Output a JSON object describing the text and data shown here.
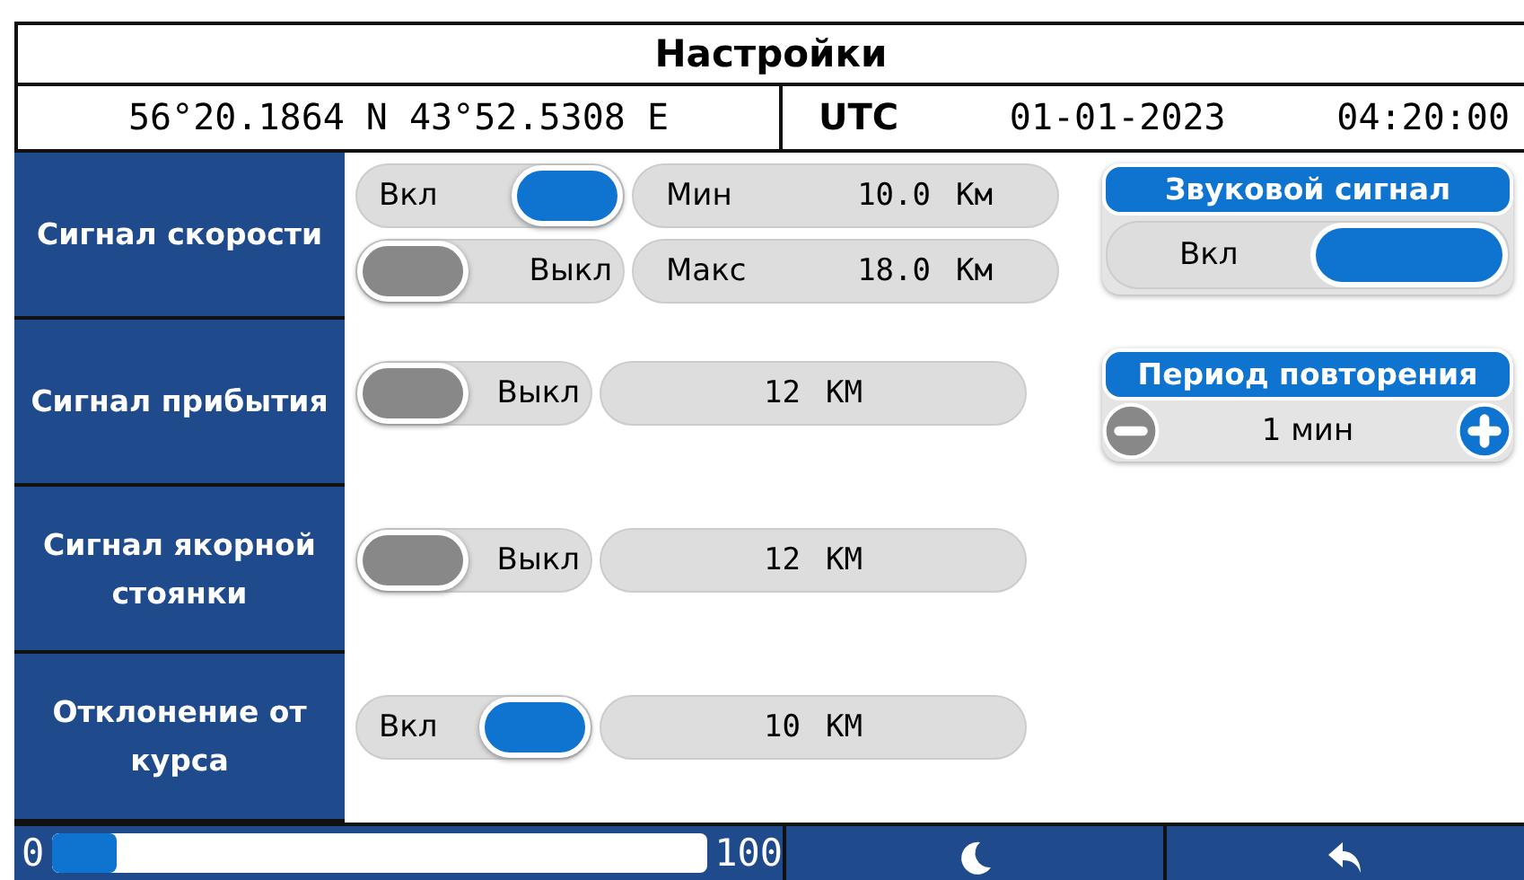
{
  "title": "Настройки",
  "position": {
    "coordinates": "56°20.1864 N 43°52.5308 E",
    "timezone": "UTC",
    "date": "01-01-2023",
    "time": "04:20:00"
  },
  "alarms": [
    {
      "label": "Сигнал скорости",
      "toggles": [
        {
          "state_label": "Вкл",
          "on": true
        },
        {
          "state_label": "Выкл",
          "on": false
        }
      ],
      "values": [
        {
          "prefix": "Мин",
          "value": "10.0",
          "unit": "Км"
        },
        {
          "prefix": "Макс",
          "value": "18.0",
          "unit": "Км"
        }
      ]
    },
    {
      "label": "Сигнал прибытия",
      "toggles": [
        {
          "state_label": "Выкл",
          "on": false
        }
      ],
      "values": [
        {
          "value": "12",
          "unit": "КМ"
        }
      ]
    },
    {
      "label": "Сигнал якорной стоянки",
      "toggles": [
        {
          "state_label": "Выкл",
          "on": false
        }
      ],
      "values": [
        {
          "value": "12",
          "unit": "КМ"
        }
      ]
    },
    {
      "label": "Отклонение от курса",
      "toggles": [
        {
          "state_label": "Вкл",
          "on": true
        }
      ],
      "values": [
        {
          "value": "10",
          "unit": "КМ"
        }
      ]
    }
  ],
  "sound": {
    "heading": "Звуковой сигнал",
    "state_label": "Вкл",
    "on": true
  },
  "repeat": {
    "heading": "Период повторения",
    "value": "1 мин"
  },
  "brightness": {
    "min": "0",
    "max": "100",
    "level": 0.1
  }
}
